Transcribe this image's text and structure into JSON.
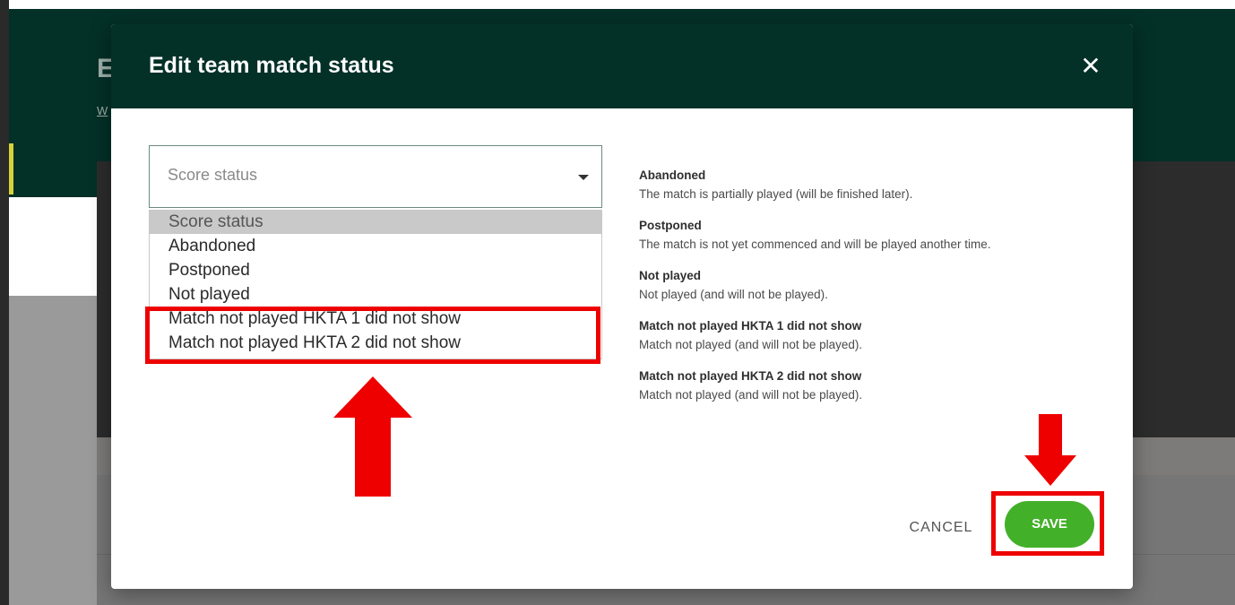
{
  "background": {
    "title_fragment": "E",
    "subtitle_fragment": "W"
  },
  "modal": {
    "title": "Edit team match status",
    "close_icon": "close-icon"
  },
  "select": {
    "value": "Score status",
    "options": [
      "Score status",
      "Abandoned",
      "Postponed",
      "Not played",
      "Match not played HKTA 1 did not show",
      "Match not played HKTA 2 did not show"
    ],
    "highlighted_option_index": 0
  },
  "descriptions": [
    {
      "title": "Abandoned",
      "text": "The match is partially played (will be finished later)."
    },
    {
      "title": "Postponed",
      "text": "The match is not yet commenced and will be played another time."
    },
    {
      "title": "Not played",
      "text": "Not played (and will not be played)."
    },
    {
      "title": "Match not played HKTA 1 did not show",
      "text": "Match not played (and will not be played)."
    },
    {
      "title": "Match not played HKTA 2 did not show",
      "text": "Match not played (and will not be played)."
    }
  ],
  "buttons": {
    "cancel_label": "CANCEL",
    "save_label": "SAVE"
  },
  "colors": {
    "header": "#033027",
    "save": "#43b02a",
    "annotation": "#ee0000"
  }
}
